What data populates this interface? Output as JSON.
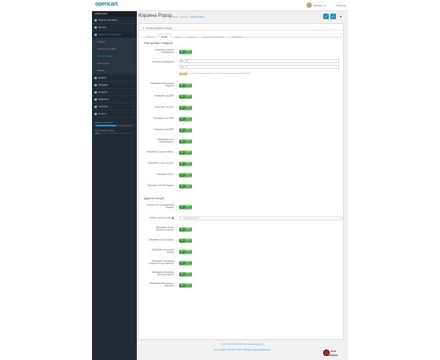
{
  "header": {
    "logo": "opencart",
    "user_name": "Lilia Dev",
    "logout_label": "Выход"
  },
  "sidebar": {
    "nav_title": "НАВИГАЦИЯ",
    "items": [
      {
        "label": "Панель состояния",
        "type": "main"
      },
      {
        "label": "Каталог",
        "type": "main",
        "arrow": "›"
      },
      {
        "label": "Модули / Расширения",
        "type": "main",
        "active": true,
        "arrow": "›"
      },
      {
        "label": "Модули",
        "type": "sub"
      },
      {
        "label": "Способы доставки",
        "type": "sub"
      },
      {
        "label": "Корзина Popup",
        "type": "sub",
        "current": true
      },
      {
        "label": "Конструктор",
        "type": "sub"
      },
      {
        "label": "Заказы",
        "type": "sub"
      },
      {
        "label": "Дизайн",
        "type": "main",
        "arrow": "›"
      },
      {
        "label": "Продажи",
        "type": "main",
        "arrow": "›"
      },
      {
        "label": "Клиенты",
        "type": "main",
        "arrow": "›"
      },
      {
        "label": "Маркетинг",
        "type": "main",
        "arrow": "›"
      },
      {
        "label": "Система",
        "type": "main",
        "arrow": "›"
      },
      {
        "label": "Отчеты",
        "type": "main",
        "arrow": "›"
      }
    ],
    "progress": [
      {
        "label": "Заказы в обработке",
        "percent": 55
      },
      {
        "label": "Выполненные заказы",
        "percent": 10
      }
    ]
  },
  "page": {
    "title": "Корзина Popup",
    "breadcrumbs": [
      "Главная",
      "Модули",
      "Корзина Popup"
    ],
    "save_icon": "save-icon",
    "back_icon": "back-icon"
  },
  "panel": {
    "heading": "Редактирование корзины",
    "tabs": [
      "Личный",
      "Дизайн",
      "Настр.",
      "Сервисы",
      "Специальное в корзине",
      "Поддержка"
    ],
    "active_tab": 1
  },
  "section_goods": {
    "title": "Настройки товаров",
    "toggles": [
      {
        "label": "Показывать главное изображение",
        "off": "Да",
        "on": "Нет"
      }
    ],
    "dim": {
      "label": "Размеры изображения",
      "width_prefix": "W",
      "width_value": "80",
      "height_prefix": "H",
      "height_value": "80",
      "warn_badge": "Внимание",
      "warn_text": "если не изменять размер изображения, то они необходимы корректному отображению"
    },
    "toggles2": [
      {
        "label": "Показывать дату выхода продукта"
      },
      {
        "label": "Показывать код EAN"
      },
      {
        "label": "Показывать код JAN"
      },
      {
        "label": "Показывать код ISBN"
      },
      {
        "label": "Показывать код MPN"
      },
      {
        "label": "Показывать поле Производитель"
      },
      {
        "label": "Показывать Бонусные баллы"
      },
      {
        "label": "Показывать статус наличия"
      },
      {
        "label": "Показывать налог"
      },
      {
        "label": "Показывать SKU/НР модели"
      }
    ],
    "toggle_off": "Да",
    "toggle_on": "Нет"
  },
  "section_other": {
    "title": "Другие опции",
    "toggle1": {
      "label": "Кнопки итого в специальной корзине"
    },
    "input": {
      "label": "Атрибуты родительской",
      "value": "#quickPRB-wrap-link"
    },
    "toggles": [
      {
        "label": "Показывать кнопку Сохранить корзину"
      },
      {
        "label": "Показывать счет в корзине"
      },
      {
        "label": "Показывать блок ввода Купона"
      },
      {
        "label": "Показывать блок ввода Подарочного сертификата"
      },
      {
        "label": "Показывать блок ввода Бонусных баллов"
      },
      {
        "label": "Показывать блок расчета Доставки"
      }
    ]
  },
  "footer": {
    "line1": "OpenCart © 2009-2018 Все права защищены.",
    "line2": "Купить Модуль OpenCart  |  Ответ поддержки  |  Здесь документация"
  },
  "badge": {
    "line1": "WEB",
    "line2": "SPECIAL"
  }
}
